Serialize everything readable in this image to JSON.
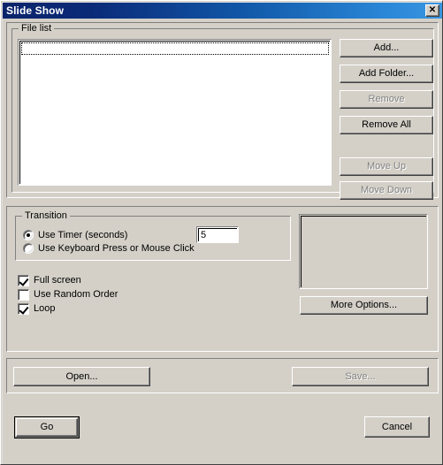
{
  "window": {
    "title": "Slide Show",
    "close_icon": "close-x",
    "titlebar_gradient_start": "#0a246a",
    "titlebar_gradient_end": "#3a95e0",
    "face_color": "#d4d0c8"
  },
  "file_list_group": {
    "legend": "File list",
    "items": [],
    "focused_row_index": 0
  },
  "list_buttons": [
    {
      "label": "Add...",
      "enabled": true,
      "name": "add-button"
    },
    {
      "label": "Add Folder...",
      "enabled": true,
      "name": "add-folder-button"
    },
    {
      "label": "Remove",
      "enabled": false,
      "name": "remove-button"
    },
    {
      "label": "Remove All",
      "enabled": true,
      "name": "remove-all-button"
    },
    {
      "label": "Move Up",
      "enabled": false,
      "name": "move-up-button"
    },
    {
      "label": "Move Down",
      "enabled": false,
      "name": "move-down-button"
    }
  ],
  "transition_group": {
    "legend": "Transition",
    "radios": [
      {
        "label": "Use Timer (seconds)",
        "checked": true
      },
      {
        "label": "Use Keyboard Press or Mouse Click",
        "checked": false
      }
    ],
    "timer_value": "5"
  },
  "options": {
    "checkboxes": [
      {
        "label": "Full screen",
        "checked": true
      },
      {
        "label": "Use Random Order",
        "checked": false
      },
      {
        "label": "Loop",
        "checked": true
      }
    ]
  },
  "more_options": {
    "label": "More Options...",
    "enabled": true
  },
  "file_actions": [
    {
      "label": "Open...",
      "enabled": true,
      "name": "open-button"
    },
    {
      "label": "Save...",
      "enabled": false,
      "name": "save-button"
    }
  ],
  "dialog_actions": [
    {
      "label": "Go",
      "enabled": true,
      "default": true,
      "name": "go-button"
    },
    {
      "label": "Cancel",
      "enabled": true,
      "default": false,
      "name": "cancel-button"
    }
  ]
}
